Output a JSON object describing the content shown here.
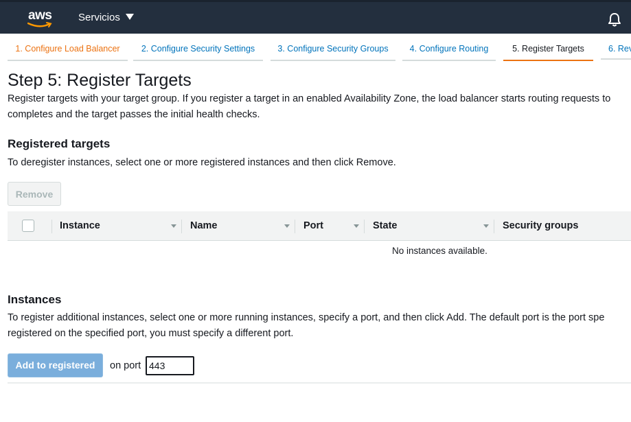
{
  "header": {
    "logo_text": "aws",
    "services_label": "Servicios",
    "bell_icon": "notification-bell-icon"
  },
  "wizard": {
    "tabs": [
      {
        "label": "1. Configure Load Balancer",
        "state": "done"
      },
      {
        "label": "2. Configure Security Settings",
        "state": "pending"
      },
      {
        "label": "3. Configure Security Groups",
        "state": "pending"
      },
      {
        "label": "4. Configure Routing",
        "state": "pending"
      },
      {
        "label": "5. Register Targets",
        "state": "active"
      },
      {
        "label": "6. Rev",
        "state": "pending"
      }
    ]
  },
  "page": {
    "title": "Step 5: Register Targets",
    "intro_line1": "Register targets with your target group. If you register a target in an enabled Availability Zone, the load balancer starts routing requests to",
    "intro_line2": "completes and the target passes the initial health checks."
  },
  "registered": {
    "heading": "Registered targets",
    "description": "To deregister instances, select one or more registered instances and then click Remove.",
    "remove_label": "Remove",
    "columns": [
      "Instance",
      "Name",
      "Port",
      "State",
      "Security groups"
    ],
    "empty_message": "No instances available."
  },
  "instances": {
    "heading": "Instances",
    "description_line1": "To register additional instances, select one or more running instances, specify a port, and then click Add. The default port is the port spe",
    "description_line2": "registered on the specified port, you must specify a different port.",
    "add_label": "Add to registered",
    "on_port_label": "on port",
    "port_value": "443"
  },
  "colors": {
    "nav_bg": "#232f3e",
    "done_tab": "#ec7211",
    "link_tab": "#0073bb",
    "primary_button": "#7aaedc"
  }
}
